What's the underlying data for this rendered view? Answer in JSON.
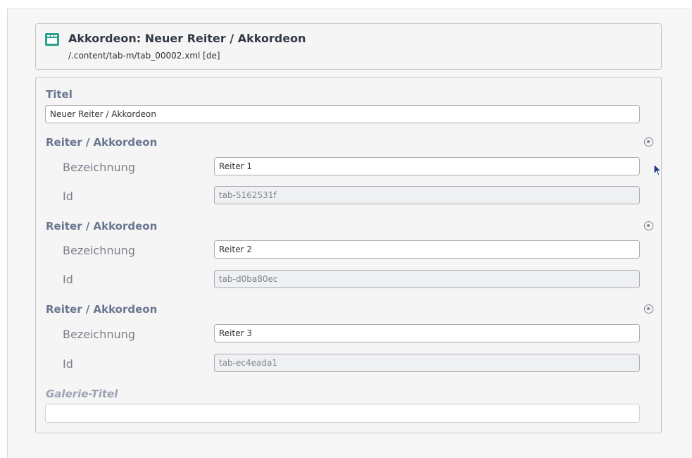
{
  "header": {
    "title": "Akkordeon: Neuer Reiter / Akkordeon",
    "path": "/.content/tab-m/tab_00002.xml [de]",
    "icon": "tab-element-icon",
    "accent_color": "#2ba08a"
  },
  "form": {
    "title_label": "Titel",
    "title_value": "Neuer Reiter / Akkordeon",
    "tabs": [
      {
        "section_label": "Reiter / Akkordeon",
        "name_label": "Bezeichnung",
        "name_value": "Reiter 1",
        "id_label": "Id",
        "id_value": "tab-5162531f"
      },
      {
        "section_label": "Reiter / Akkordeon",
        "name_label": "Bezeichnung",
        "name_value": "Reiter 2",
        "id_label": "Id",
        "id_value": "tab-d0ba80ec"
      },
      {
        "section_label": "Reiter / Akkordeon",
        "name_label": "Bezeichnung",
        "name_value": "Reiter 3",
        "id_label": "Id",
        "id_value": "tab-ec4eada1"
      }
    ],
    "gallery_title_label": "Galerie-Titel",
    "gallery_title_value": ""
  }
}
